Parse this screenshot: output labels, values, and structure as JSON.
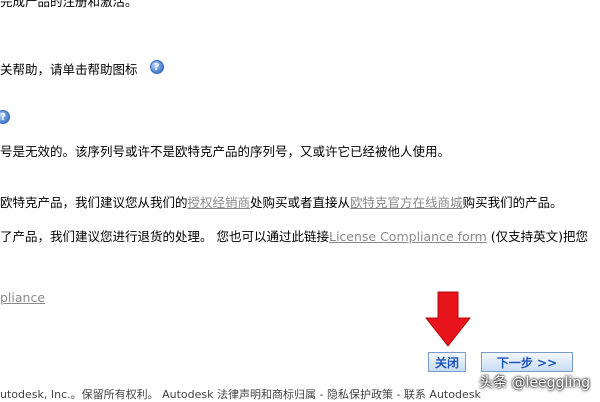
{
  "lines": {
    "l1": "完成产品的注册和激活。",
    "l2": "关帮助，请单击帮助图标",
    "l3": "号是无效的。该序列号或许不是欧特克产品的序列号，又或许它已经被他人使用。",
    "l4_pre": "欧特克产品，我们建议您从我们的",
    "l4_link1": "授权经销商",
    "l4_mid": "处购买或者直接从",
    "l4_link2": "欧特克官方在线商城",
    "l4_post": "购买我们的产品。",
    "l5_pre": "了产品，我们建议您进行退货的处理。 您也可以通过此链接",
    "l5_link": "License Compliance form",
    "l5_post": " (仅支持英文)把您",
    "l6_link": "pliance"
  },
  "buttons": {
    "close": "关闭",
    "next": "下一步 >>"
  },
  "footer": "utodesk, Inc.。保留所有权利。 Autodesk 法律声明和商标归属 - 隐私保护政策 - 联系  Autodesk",
  "watermark": "头条 @leeggling",
  "icons": {
    "help": "?"
  },
  "colors": {
    "accent_red": "#e8141b",
    "link_gray": "#8a8a8a",
    "button_text": "#1d56b8"
  }
}
